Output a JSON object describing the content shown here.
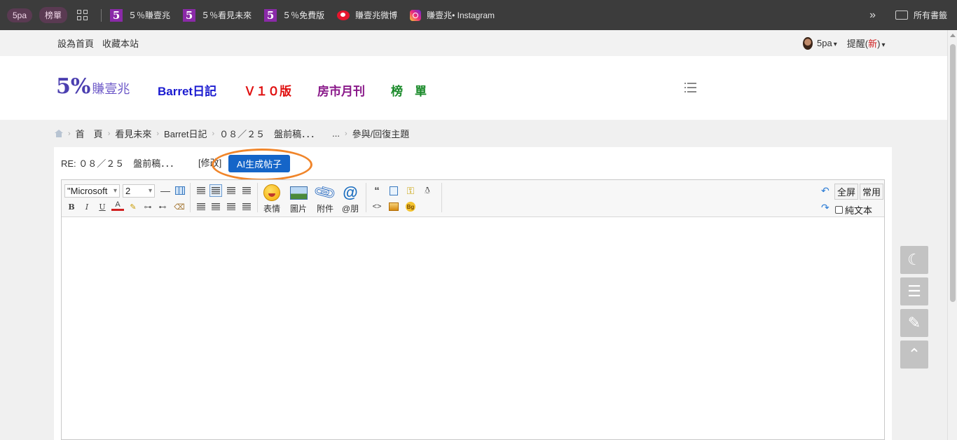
{
  "bookmarks_bar": {
    "profile_pill": "5pa",
    "ranking_pill": "榜單",
    "items": [
      {
        "label": "５％賺壹兆",
        "icon": "five-logo-icon"
      },
      {
        "label": "５％看見未來",
        "icon": "five-logo-icon"
      },
      {
        "label": "５％免費版",
        "icon": "five-logo-icon"
      },
      {
        "label": "賺壹兆微博",
        "icon": "weibo-icon"
      },
      {
        "label": "賺壹兆• Instagram",
        "icon": "instagram-icon"
      }
    ],
    "more": "»",
    "all_bookmarks": "所有書籤"
  },
  "topnav": {
    "set_home": "設為首頁",
    "bookmark_site": "收藏本站",
    "username": "5pa",
    "notify_prefix": "提醒(",
    "notify_new": "新",
    "notify_suffix": ")"
  },
  "header": {
    "logo_big": "5%",
    "logo_small": "賺壹兆",
    "nav": [
      {
        "label": "Barret日記",
        "color": "#1a1ad0"
      },
      {
        "label": "Ｖ１０版",
        "color": "#e01010"
      },
      {
        "label": "房市月刊",
        "color": "#8a1a8a"
      },
      {
        "label": "榜　單",
        "color": "#1a8a2a"
      }
    ]
  },
  "breadcrumb": [
    "首　頁",
    "看見未來",
    "Barret日記",
    "０８／２５　盤前稿．．．",
    "...",
    "參與/回復主題"
  ],
  "post": {
    "title": "RE: ０８／２５　盤前稿．．．",
    "edit_label": "[修改]",
    "ai_button": "AI生成帖子"
  },
  "editor": {
    "font_value": "\"Microsoft",
    "size_value": "2",
    "bold": "B",
    "italic": "I",
    "underline": "U",
    "font_color": "A",
    "emoji_label": "表情",
    "image_label": "圖片",
    "attach_label": "附件",
    "mention_label": "@朋",
    "quote": "“",
    "code": "<>",
    "fullscreen": "全屏",
    "common": "常用",
    "plain_text": "純文本"
  },
  "colors": {
    "ai_button": "#1565c8",
    "highlight_ring": "#f0852a",
    "bookmark_bar": "#3c3c3c"
  }
}
